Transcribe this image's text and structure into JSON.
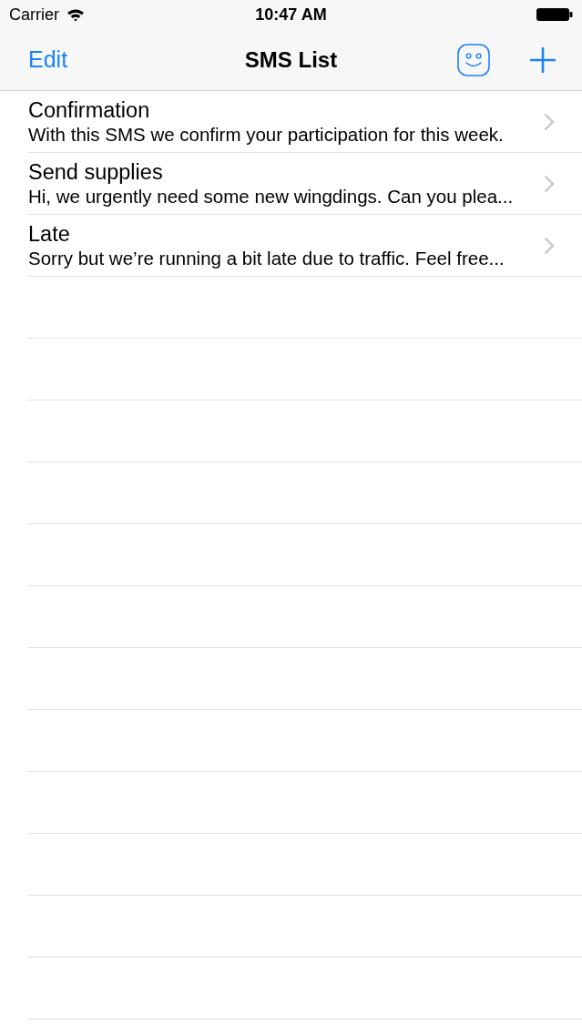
{
  "status_bar": {
    "carrier": "Carrier",
    "time": "10:47 AM"
  },
  "nav_bar": {
    "left_button": "Edit",
    "title": "SMS List"
  },
  "messages": [
    {
      "title": "Confirmation",
      "preview": "With this SMS we confirm your participation for this week."
    },
    {
      "title": "Send supplies",
      "preview": "Hi, we urgently need some new wingdings. Can you plea..."
    },
    {
      "title": "Late",
      "preview": "Sorry but we’re running a bit late due to traffic. Feel free..."
    }
  ]
}
